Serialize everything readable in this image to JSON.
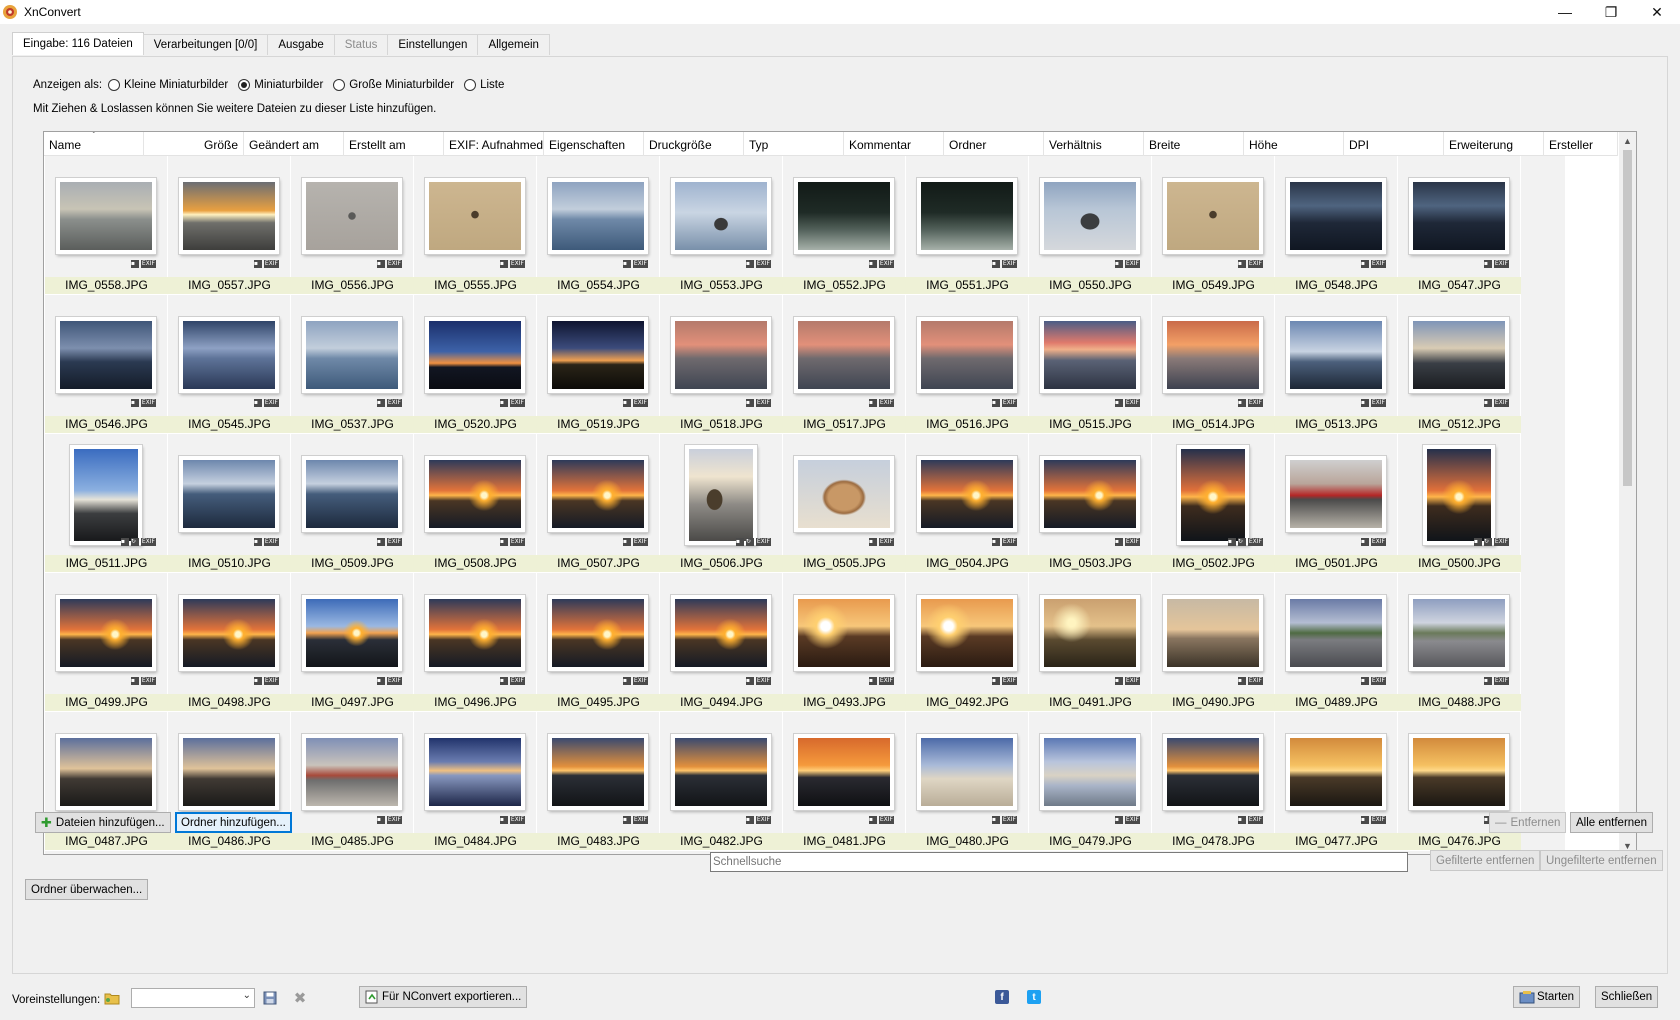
{
  "window": {
    "title": "XnConvert",
    "minimize_glyph": "—",
    "maximize_glyph": "❐",
    "close_glyph": "✕"
  },
  "tabs": [
    {
      "label": "Eingabe: 116 Dateien",
      "state": "active"
    },
    {
      "label": "Verarbeitungen [0/0]",
      "state": "normal"
    },
    {
      "label": "Ausgabe",
      "state": "normal"
    },
    {
      "label": "Status",
      "state": "disabled"
    },
    {
      "label": "Einstellungen",
      "state": "normal"
    },
    {
      "label": "Allgemein",
      "state": "normal"
    }
  ],
  "view": {
    "label": "Anzeigen als:",
    "options": [
      {
        "label": "Kleine Miniaturbilder",
        "selected": false
      },
      {
        "label": "Miniaturbilder",
        "selected": true
      },
      {
        "label": "Große Miniaturbilder",
        "selected": false
      },
      {
        "label": "Liste",
        "selected": false
      }
    ],
    "hint": "Mit Ziehen & Loslassen können Sie weitere Dateien zu dieser Liste hinzufügen."
  },
  "columns": [
    "Name",
    "Größe",
    "Geändert am",
    "Erstellt am",
    "EXIF: Aufnahmed",
    "Eigenschaften",
    "Druckgröße",
    "Typ",
    "Kommentar",
    "Ordner",
    "Verhältnis",
    "Breite",
    "Höhe",
    "DPI",
    "Erweiterung",
    "Ersteller"
  ],
  "badges": {
    "info": "▪",
    "rotate": "↻",
    "exif": "EXIF"
  },
  "files": [
    {
      "name": "IMG_0558.JPG",
      "type": "seacloud"
    },
    {
      "name": "IMG_0557.JPG",
      "type": "seaglow"
    },
    {
      "name": "IMG_0556.JPG",
      "type": "sandgray"
    },
    {
      "name": "IMG_0555.JPG",
      "type": "sandtan"
    },
    {
      "name": "IMG_0554.JPG",
      "type": "bluesea"
    },
    {
      "name": "IMG_0553.JPG",
      "type": "bluesea2"
    },
    {
      "name": "IMG_0552.JPG",
      "type": "darksea"
    },
    {
      "name": "IMG_0551.JPG",
      "type": "darksea"
    },
    {
      "name": "IMG_0550.JPG",
      "type": "sandblue"
    },
    {
      "name": "IMG_0549.JPG",
      "type": "sandtan"
    },
    {
      "name": "IMG_0548.JPG",
      "type": "darkblue"
    },
    {
      "name": "IMG_0547.JPG",
      "type": "darkblue"
    },
    {
      "name": "IMG_0546.JPG",
      "type": "duskblue"
    },
    {
      "name": "IMG_0545.JPG",
      "type": "cloudblue"
    },
    {
      "name": "IMG_0537.JPG",
      "type": "bluesea"
    },
    {
      "name": "IMG_0520.JPG",
      "type": "bluehorizon"
    },
    {
      "name": "IMG_0519.JPG",
      "type": "darkhorizon"
    },
    {
      "name": "IMG_0518.JPG",
      "type": "pinkdusk"
    },
    {
      "name": "IMG_0517.JPG",
      "type": "pinkdusk"
    },
    {
      "name": "IMG_0516.JPG",
      "type": "pinkdusk"
    },
    {
      "name": "IMG_0515.JPG",
      "type": "pinkcloud"
    },
    {
      "name": "IMG_0514.JPG",
      "type": "orangesky"
    },
    {
      "name": "IMG_0513.JPG",
      "type": "bluebeach"
    },
    {
      "name": "IMG_0512.JPG",
      "type": "duskbeach"
    },
    {
      "name": "IMG_0511.JPG",
      "type": "portraitblue",
      "portrait": true,
      "rot": true
    },
    {
      "name": "IMG_0510.JPG",
      "type": "eveningsea"
    },
    {
      "name": "IMG_0509.JPG",
      "type": "eveningsea"
    },
    {
      "name": "IMG_0508.JPG",
      "type": "sunset"
    },
    {
      "name": "IMG_0507.JPG",
      "type": "sunset"
    },
    {
      "name": "IMG_0506.JPG",
      "type": "portraitrock",
      "portrait": true,
      "rot": true
    },
    {
      "name": "IMG_0505.JPG",
      "type": "shell"
    },
    {
      "name": "IMG_0504.JPG",
      "type": "sunset"
    },
    {
      "name": "IMG_0503.JPG",
      "type": "sunset"
    },
    {
      "name": "IMG_0502.JPG",
      "type": "sunsetportrait",
      "portrait": true,
      "rot": true
    },
    {
      "name": "IMG_0501.JPG",
      "type": "cars"
    },
    {
      "name": "IMG_0500.JPG",
      "type": "sunsetportrait",
      "portrait": true,
      "rot": true
    },
    {
      "name": "IMG_0499.JPG",
      "type": "sunset"
    },
    {
      "name": "IMG_0498.JPG",
      "type": "sunset"
    },
    {
      "name": "IMG_0497.JPG",
      "type": "sunsetblue"
    },
    {
      "name": "IMG_0496.JPG",
      "type": "sunset"
    },
    {
      "name": "IMG_0495.JPG",
      "type": "sunset"
    },
    {
      "name": "IMG_0494.JPG",
      "type": "sunset"
    },
    {
      "name": "IMG_0493.JPG",
      "type": "sunsetbright"
    },
    {
      "name": "IMG_0492.JPG",
      "type": "sunsetbright"
    },
    {
      "name": "IMG_0491.JPG",
      "type": "goldsea"
    },
    {
      "name": "IMG_0490.JPG",
      "type": "palesunset"
    },
    {
      "name": "IMG_0489.JPG",
      "type": "street"
    },
    {
      "name": "IMG_0488.JPG",
      "type": "street2"
    },
    {
      "name": "IMG_0487.JPG",
      "type": "duskbeach2"
    },
    {
      "name": "IMG_0486.JPG",
      "type": "duskbeach2"
    },
    {
      "name": "IMG_0485.JPG",
      "type": "parking"
    },
    {
      "name": "IMG_0484.JPG",
      "type": "reflect"
    },
    {
      "name": "IMG_0483.JPG",
      "type": "horizonorange"
    },
    {
      "name": "IMG_0482.JPG",
      "type": "horizonorange"
    },
    {
      "name": "IMG_0481.JPG",
      "type": "orangeglow"
    },
    {
      "name": "IMG_0480.JPG",
      "type": "beachpeople"
    },
    {
      "name": "IMG_0479.JPG",
      "type": "beachwater"
    },
    {
      "name": "IMG_0478.JPG",
      "type": "horizonorange"
    },
    {
      "name": "IMG_0477.JPG",
      "type": "goldhorizon"
    },
    {
      "name": "IMG_0476.JPG",
      "type": "goldhorizon"
    }
  ],
  "buttons": {
    "add_files": "Dateien hinzufügen...",
    "add_folder": "Ordner hinzufügen...",
    "remove": "Entfernen",
    "remove_all": "Alle entfernen",
    "remove_filtered": "Gefilterte entfernen",
    "remove_unfiltered": "Ungefilterte entfernen",
    "watch_folder": "Ordner überwachen...",
    "export_nconvert": "Für NConvert exportieren...",
    "start": "Starten",
    "close": "Schließen"
  },
  "search": {
    "placeholder": "Schnellsuche",
    "value": ""
  },
  "presets": {
    "label": "Voreinstellungen:",
    "selected": ""
  },
  "icons": {
    "folder": "folder-icon",
    "save": "save-icon",
    "delete": "delete-icon",
    "facebook": "facebook-icon",
    "twitter": "twitter-icon"
  },
  "colors": {
    "filename_bg": "#eef1d6",
    "focus_blue": "#0078d7"
  }
}
